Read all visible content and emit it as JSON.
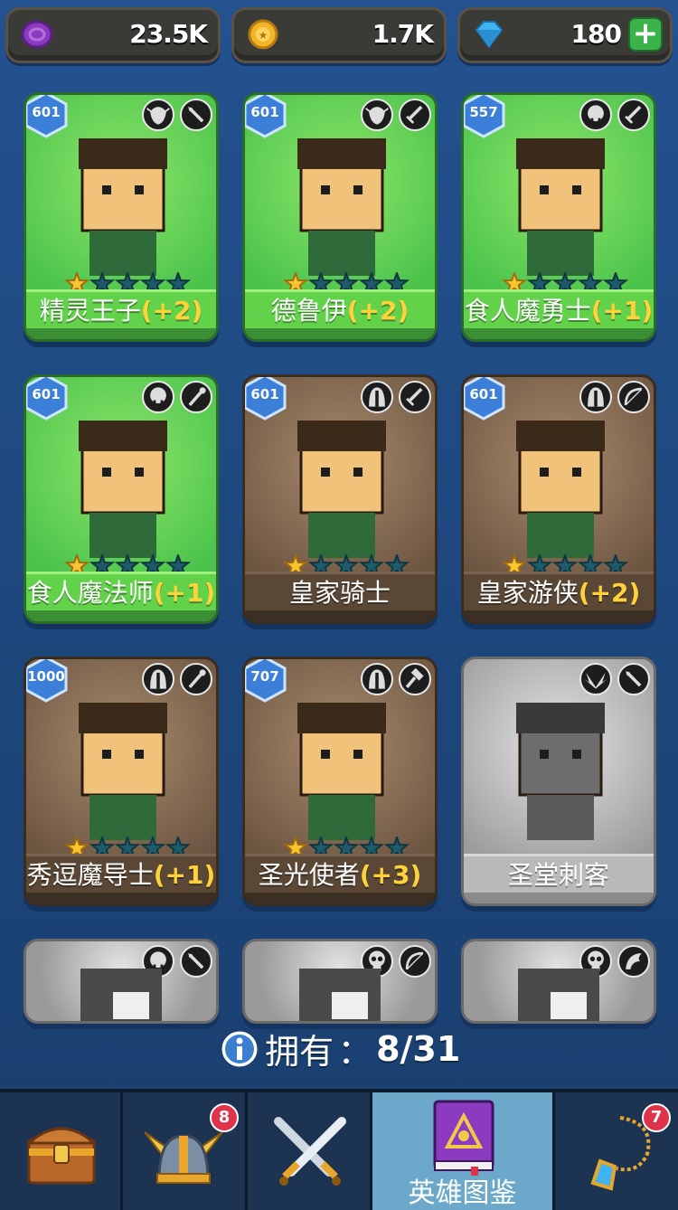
{
  "currencies": [
    {
      "name": "potion",
      "value": "23.5K",
      "color": "#8a3bbf"
    },
    {
      "name": "gold",
      "value": "1.7K",
      "color": "#f2b52a"
    },
    {
      "name": "gem",
      "value": "180",
      "color": "#3fb4f0",
      "has_plus": true
    }
  ],
  "heroes": [
    {
      "name": "精灵王子",
      "bonus": "(+2)",
      "level": "601",
      "bg": "green",
      "stars": 1,
      "class_icons": [
        "elf-icon",
        "dagger-icon"
      ]
    },
    {
      "name": "德鲁伊",
      "bonus": "(+2)",
      "level": "601",
      "bg": "green",
      "stars": 1,
      "class_icons": [
        "elf-icon",
        "sword-icon"
      ]
    },
    {
      "name": "食人魔勇士",
      "bonus": "(+1)",
      "level": "557",
      "bg": "green",
      "stars": 1,
      "class_icons": [
        "orc-icon",
        "sword-icon"
      ]
    },
    {
      "name": "食人魔法师",
      "bonus": "(+1)",
      "level": "601",
      "bg": "green",
      "stars": 1,
      "class_icons": [
        "orc-icon",
        "staff-icon"
      ]
    },
    {
      "name": "皇家骑士",
      "bonus": "",
      "level": "601",
      "bg": "brown",
      "stars": 1,
      "class_icons": [
        "helmet-icon",
        "sword-icon"
      ]
    },
    {
      "name": "皇家游侠",
      "bonus": "(+2)",
      "level": "601",
      "bg": "brown",
      "stars": 1,
      "class_icons": [
        "helmet-icon",
        "bow-icon"
      ]
    },
    {
      "name": "秀逗魔导士",
      "bonus": "(+1)",
      "level": "1000",
      "bg": "brown",
      "stars": 1,
      "class_icons": [
        "helmet-icon",
        "staff-icon"
      ]
    },
    {
      "name": "圣光使者",
      "bonus": "(+3)",
      "level": "707",
      "bg": "brown",
      "stars": 1,
      "class_icons": [
        "helmet-icon",
        "hammer-icon"
      ]
    },
    {
      "name": "圣堂刺客",
      "bonus": "",
      "level": "",
      "bg": "gray",
      "stars": 0,
      "class_icons": [
        "wing-icon",
        "dagger-icon"
      ]
    }
  ],
  "partial_cards": [
    {
      "class_icons": [
        "orc-icon",
        "dagger-icon"
      ]
    },
    {
      "class_icons": [
        "skull-icon",
        "bow-icon"
      ]
    },
    {
      "class_icons": [
        "skull-icon",
        "dragon-icon"
      ]
    }
  ],
  "owned": {
    "label": "拥有",
    "colon": "：",
    "count": "8/31"
  },
  "tabs": [
    {
      "name": "chest",
      "label": "",
      "badge": ""
    },
    {
      "name": "heroes",
      "label": "",
      "badge": "8"
    },
    {
      "name": "battle",
      "label": "",
      "badge": ""
    },
    {
      "name": "codex",
      "label": "英雄图鉴",
      "badge": "",
      "active": true
    },
    {
      "name": "amulet",
      "label": "",
      "badge": "7"
    }
  ]
}
